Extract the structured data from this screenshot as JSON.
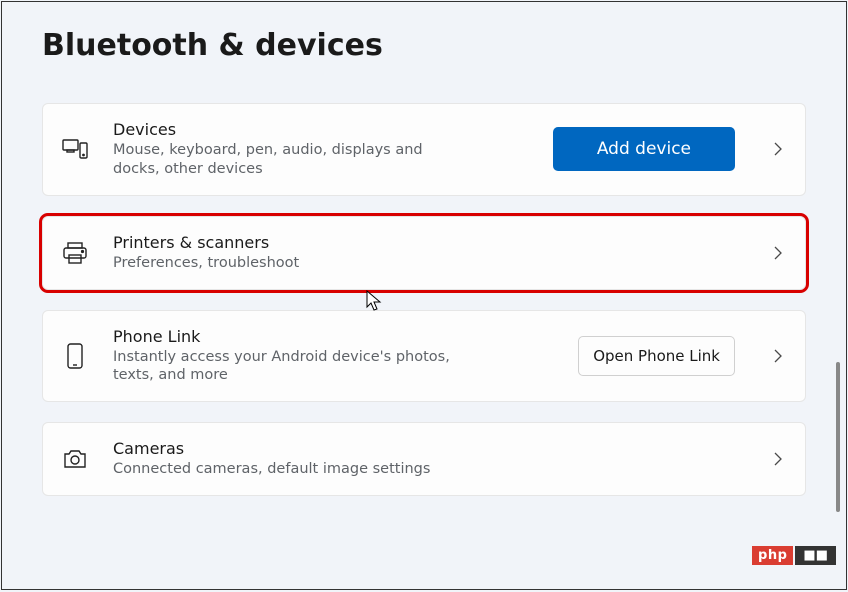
{
  "page_title": "Bluetooth & devices",
  "cards": {
    "devices": {
      "title": "Devices",
      "desc": "Mouse, keyboard, pen, audio, displays and docks, other devices",
      "button": "Add device"
    },
    "printers": {
      "title": "Printers & scanners",
      "desc": "Preferences, troubleshoot"
    },
    "phone": {
      "title": "Phone Link",
      "desc": "Instantly access your Android device's photos, texts, and more",
      "button": "Open Phone Link"
    },
    "cameras": {
      "title": "Cameras",
      "desc": "Connected cameras, default image settings"
    }
  },
  "watermark": {
    "left": "php",
    "right": "■■"
  }
}
